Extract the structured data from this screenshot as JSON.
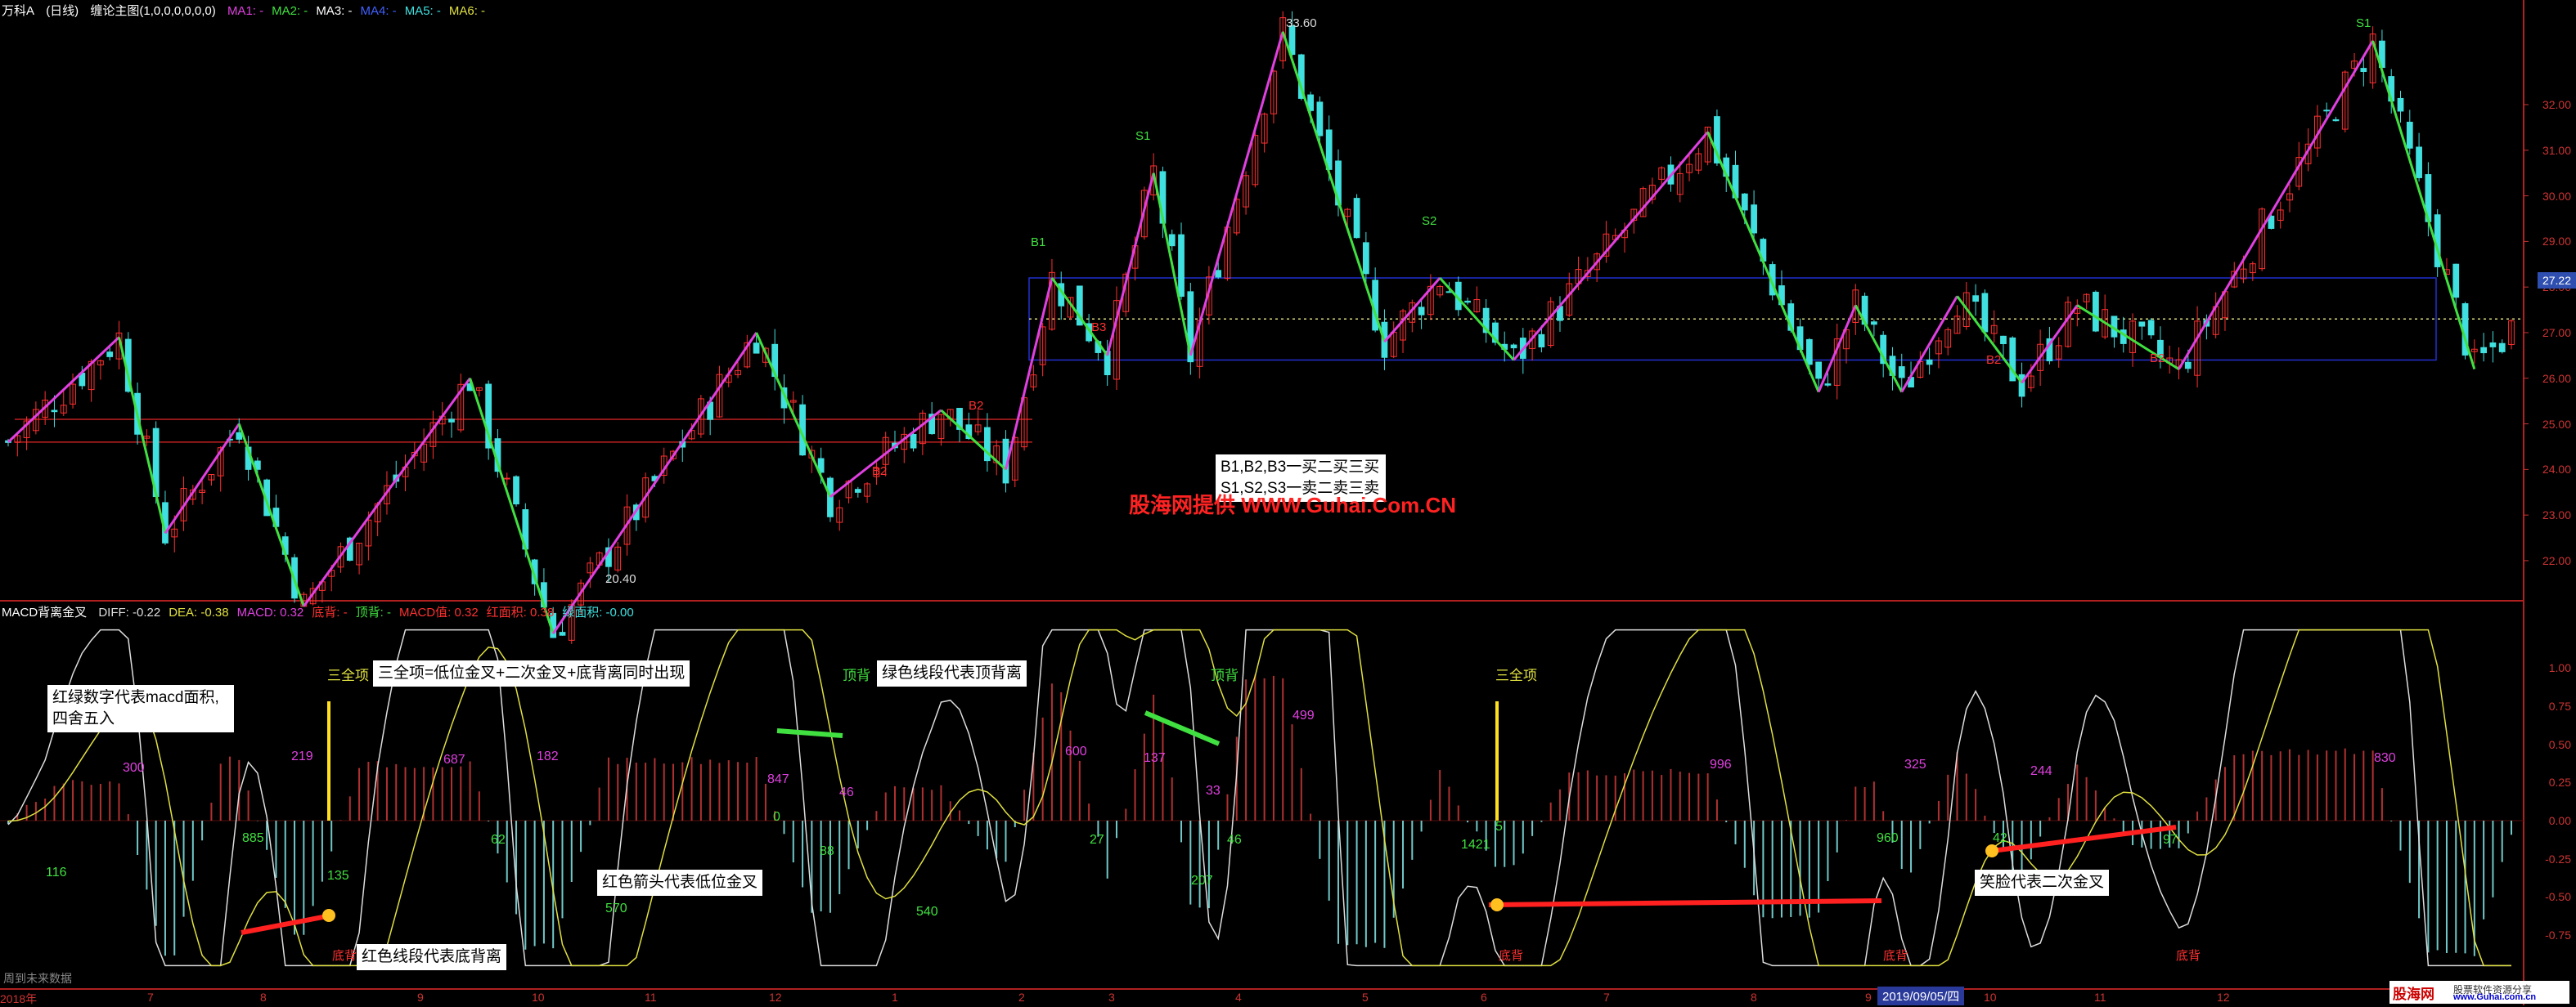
{
  "header": {
    "stock": "万科A",
    "period": "(日线)",
    "indicator": "缠论主图(1,0,0,0,0,0,0)",
    "ma_labels": [
      {
        "text": "MA1: -",
        "color": "#e040e0"
      },
      {
        "text": "MA2: -",
        "color": "#40e040"
      },
      {
        "text": "MA3: -",
        "color": "#ffffff"
      },
      {
        "text": "MA4: -",
        "color": "#4060ff"
      },
      {
        "text": "MA5: -",
        "color": "#40e0e0"
      },
      {
        "text": "MA6: -",
        "color": "#e0e040"
      }
    ]
  },
  "sub_header": {
    "name": "MACD背离金叉",
    "items": [
      {
        "text": "DIFF: -0.22",
        "color": "#dddddd"
      },
      {
        "text": "DEA: -0.38",
        "color": "#e0e040"
      },
      {
        "text": "MACD: 0.32",
        "color": "#e040e0"
      },
      {
        "text": "底背: -",
        "color": "#ff3030"
      },
      {
        "text": "顶背: -",
        "color": "#40e040"
      },
      {
        "text": "MACD值: 0.32",
        "color": "#ff3030"
      },
      {
        "text": "红面积: 0.38",
        "color": "#ff3030"
      },
      {
        "text": "绿面积: -0.00",
        "color": "#40e0e0"
      }
    ]
  },
  "price_axis": [
    "32.00",
    "31.00",
    "30.00",
    "29.00",
    "28.00",
    "27.00",
    "26.00",
    "25.00",
    "24.00",
    "23.00",
    "22.00"
  ],
  "current_price": "27.22",
  "macd_axis": [
    "1.00",
    "0.75",
    "0.50",
    "0.25",
    "0.00",
    "-0.25",
    "-0.50",
    "-0.75"
  ],
  "x_axis": [
    "2018年",
    "7",
    "8",
    "9",
    "10",
    "11",
    "12",
    "1",
    "2",
    "3",
    "4",
    "5",
    "6",
    "7",
    "8",
    "9",
    "10",
    "11",
    "12"
  ],
  "date_tag": "2019/09/05/四",
  "bottom_left": "周到未来数据",
  "price_annotations": {
    "high_peak": "33.60",
    "low": "20.40",
    "buy_signals": [
      "B1",
      "B3",
      "B2",
      "B2",
      "B2",
      "B2",
      "B2"
    ],
    "sell_signals": [
      "S1",
      "S2",
      "S1"
    ]
  },
  "chart_data": {
    "type": "line",
    "title": "",
    "ylim": [
      21.3,
      33.9
    ],
    "zigzag": [
      {
        "i": 0,
        "p": 24.6
      },
      {
        "i": 12,
        "p": 26.9
      },
      {
        "i": 17,
        "p": 22.6
      },
      {
        "i": 25,
        "p": 25.0
      },
      {
        "i": 32,
        "p": 21.0
      },
      {
        "i": 50,
        "p": 26.0
      },
      {
        "i": 59,
        "p": 20.4
      },
      {
        "i": 81,
        "p": 27.0
      },
      {
        "i": 89,
        "p": 23.4
      },
      {
        "i": 101,
        "p": 25.3
      },
      {
        "i": 108,
        "p": 24.0
      },
      {
        "i": 113,
        "p": 28.2
      },
      {
        "i": 119,
        "p": 26.5
      },
      {
        "i": 124,
        "p": 30.5
      },
      {
        "i": 128,
        "p": 26.5
      },
      {
        "i": 138,
        "p": 33.6
      },
      {
        "i": 149,
        "p": 26.8
      },
      {
        "i": 155,
        "p": 28.2
      },
      {
        "i": 163,
        "p": 26.4
      },
      {
        "i": 184,
        "p": 31.4
      },
      {
        "i": 196,
        "p": 25.7
      },
      {
        "i": 200,
        "p": 27.6
      },
      {
        "i": 205,
        "p": 25.7
      },
      {
        "i": 211,
        "p": 27.8
      },
      {
        "i": 218,
        "p": 25.9
      },
      {
        "i": 224,
        "p": 27.6
      },
      {
        "i": 235,
        "p": 26.2
      },
      {
        "i": 256,
        "p": 33.4
      },
      {
        "i": 267,
        "p": 26.2
      }
    ],
    "hub_lines": [
      24.6,
      25.1
    ],
    "hub_box": [
      26.4,
      28.2
    ],
    "dotted_line": 27.3
  },
  "macd_chart": {
    "ylim": [
      -1.05,
      1.35
    ],
    "area_labels": [
      {
        "t": "116",
        "c": "green"
      },
      {
        "t": "300",
        "c": "purple"
      },
      {
        "t": "885",
        "c": "green"
      },
      {
        "t": "219",
        "c": "purple"
      },
      {
        "t": "135",
        "c": "green"
      },
      {
        "t": "687",
        "c": "purple"
      },
      {
        "t": "62",
        "c": "green"
      },
      {
        "t": "182",
        "c": "purple"
      },
      {
        "t": "570",
        "c": "green"
      },
      {
        "t": "847",
        "c": "purple"
      },
      {
        "t": "0",
        "c": "green"
      },
      {
        "t": "88",
        "c": "green"
      },
      {
        "t": "46",
        "c": "purple"
      },
      {
        "t": "540",
        "c": "green"
      },
      {
        "t": "600",
        "c": "purple"
      },
      {
        "t": "27",
        "c": "green"
      },
      {
        "t": "137",
        "c": "purple"
      },
      {
        "t": "33",
        "c": "purple"
      },
      {
        "t": "207",
        "c": "green"
      },
      {
        "t": "46",
        "c": "green"
      },
      {
        "t": "499",
        "c": "purple"
      },
      {
        "t": "1421",
        "c": "green"
      },
      {
        "t": "5",
        "c": "green"
      },
      {
        "t": "996",
        "c": "purple"
      },
      {
        "t": "960",
        "c": "green"
      },
      {
        "t": "325",
        "c": "purple"
      },
      {
        "t": "42",
        "c": "green"
      },
      {
        "t": "244",
        "c": "purple"
      },
      {
        "t": "97",
        "c": "green"
      },
      {
        "t": "830",
        "c": "purple"
      }
    ],
    "divergence_tags": [
      "三全项",
      "三全项",
      "顶背",
      "顶背",
      "底背",
      "底背",
      "底背",
      "底背"
    ]
  },
  "notes": {
    "n1": "红绿数字代表macd面积,",
    "n1b": "四舍五入",
    "n2": "三全项=低位金叉+二次金叉+底背离同时出现",
    "n3": "绿色线段代表顶背离",
    "n4": "红色箭头代表低位金叉",
    "n5": "红色线段代表底背离",
    "n6": "笑脸代表二次金叉",
    "n7a": "B1,B2,B3一买二买三买",
    "n7b": "S1,S2,S3一卖二卖三卖"
  },
  "watermark": "股海网提供 WWW.Guhai.Com.CN",
  "logo": {
    "main": "股海网",
    "sub": "股票软件资源分享",
    "url": "www.Guhai.com.cn"
  },
  "colors": {
    "up": "#ff3030",
    "down": "#40e0e0",
    "pink": "#e040e0",
    "green": "#40e040"
  }
}
